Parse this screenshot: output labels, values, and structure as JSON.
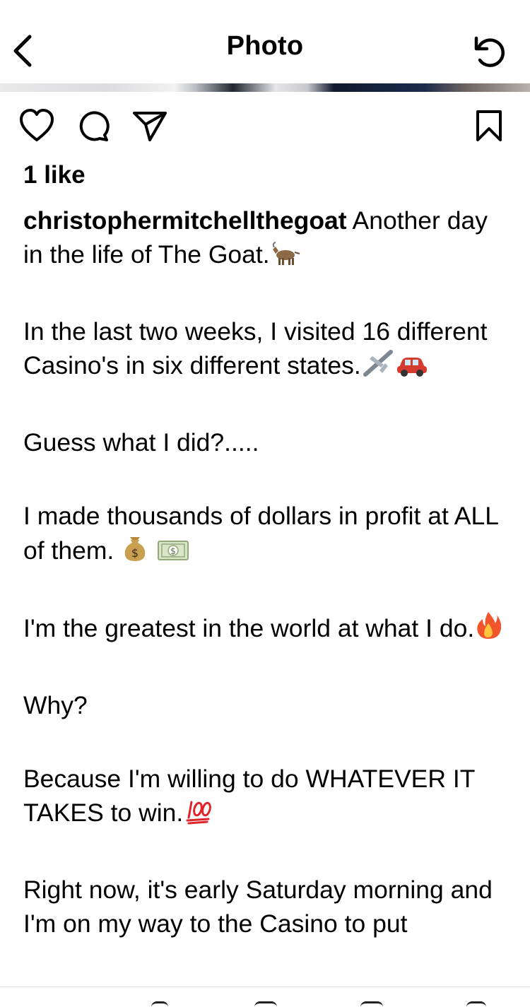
{
  "header": {
    "title": "Photo",
    "back_icon": "chevron-left-icon",
    "refresh_icon": "refresh-icon"
  },
  "actions": {
    "like_icon": "heart-icon",
    "comment_icon": "comment-bubble-icon",
    "share_icon": "paper-plane-icon",
    "save_icon": "bookmark-icon"
  },
  "post": {
    "likes": "1 like",
    "username": "christophermitchellthegoat",
    "caption": [
      {
        "text": "Another day in the life of The Goat.",
        "emoji": [
          "goat-emoji"
        ]
      },
      {
        "text": "In the last two weeks, I visited 16 different Casino's in six different states.",
        "emoji": [
          "airplane-emoji",
          "car-emoji"
        ]
      },
      {
        "text": "Guess what I did?.....",
        "emoji": []
      },
      {
        "text": "I made thousands of dollars in profit at ALL of them.",
        "emoji": [
          "money-bag-emoji",
          "dollar-banknote-emoji"
        ]
      },
      {
        "text": "I'm the greatest in the world at what I do.",
        "emoji": [
          "fire-emoji"
        ]
      },
      {
        "text": "Why?",
        "emoji": []
      },
      {
        "text": "Because I'm willing to do WHATEVER IT TAKES to win.",
        "emoji": [
          "hundred-points-emoji"
        ]
      },
      {
        "text": "Right now, it's early Saturday morning and I'm on my way to the Casino to put",
        "emoji": []
      }
    ]
  }
}
